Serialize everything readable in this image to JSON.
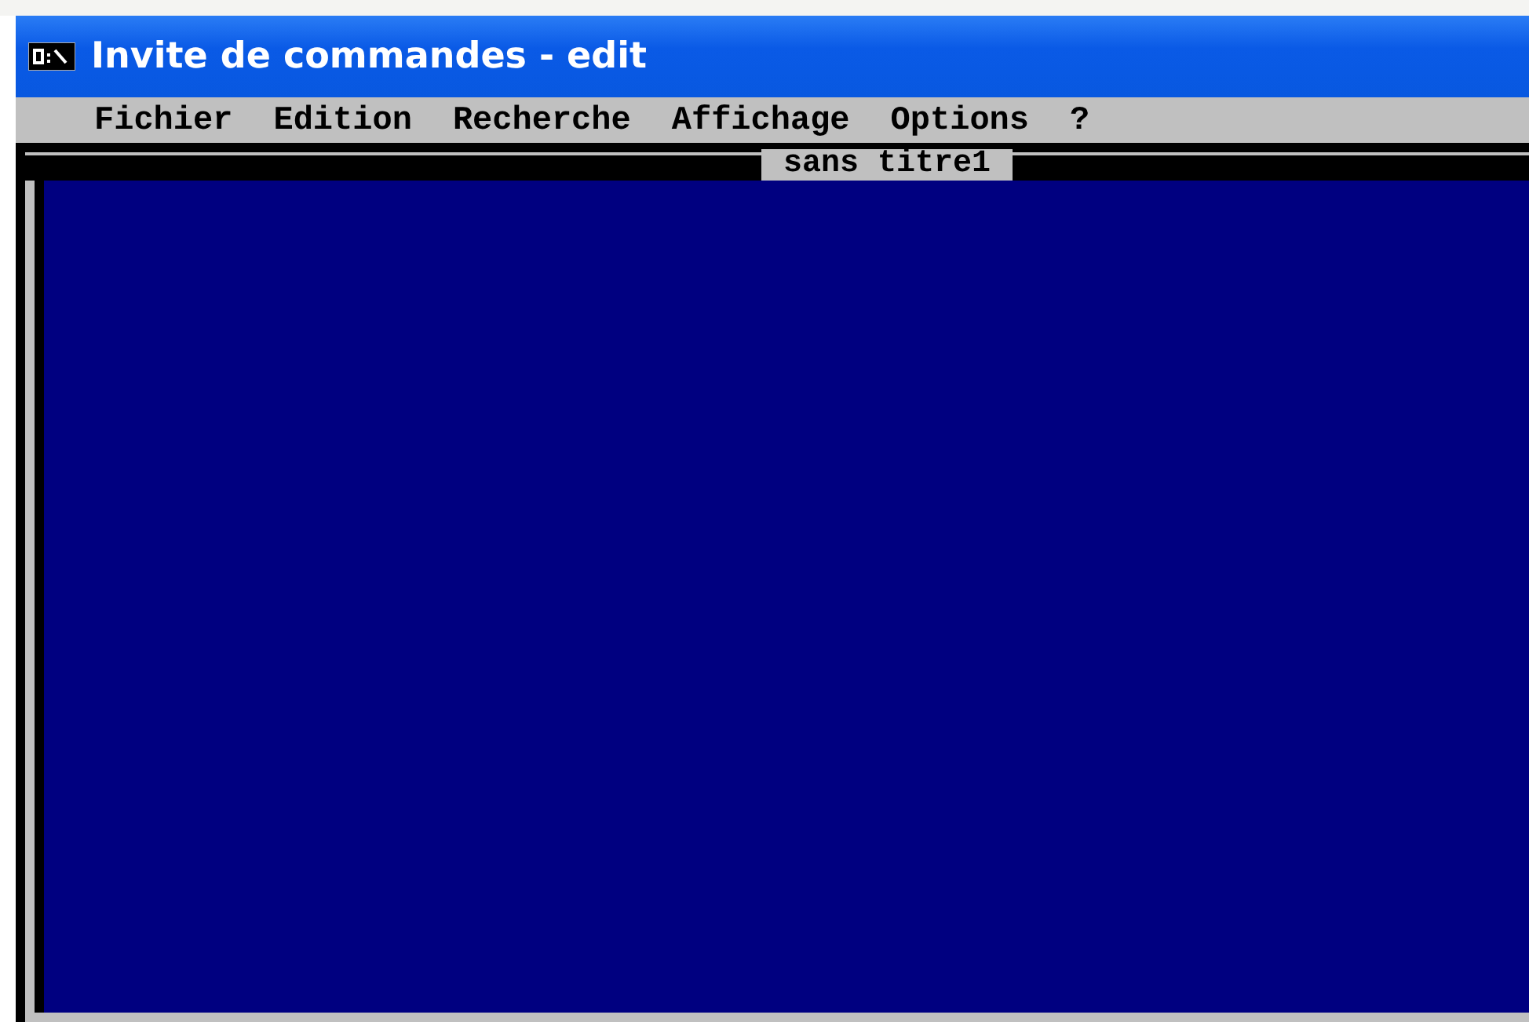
{
  "window": {
    "title": "Invite de commandes - edit"
  },
  "menu": [
    {
      "label": "Fichier"
    },
    {
      "label": "Edition"
    },
    {
      "label": "Recherche"
    },
    {
      "label": "Affichage"
    },
    {
      "label": "Options"
    },
    {
      "label": "?"
    }
  ],
  "document": {
    "title": "sans titre1"
  }
}
